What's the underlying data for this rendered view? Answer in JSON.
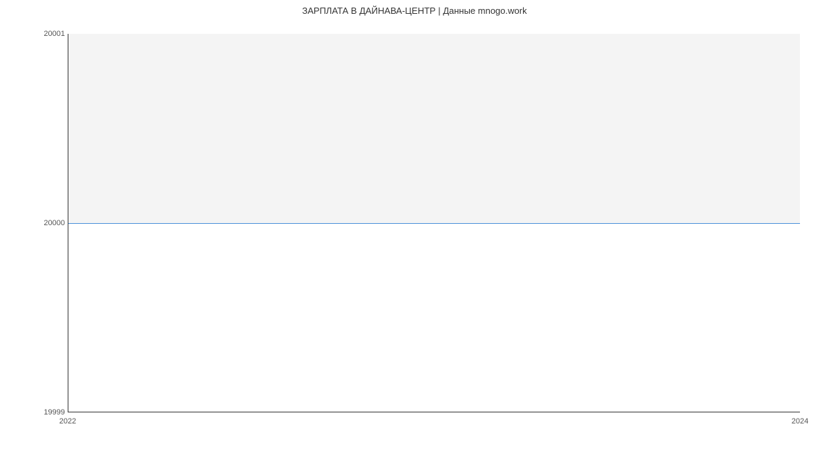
{
  "chart_data": {
    "type": "area",
    "title": "ЗАРПЛАТА В ДАЙНАВА-ЦЕНТР | Данные mnogo.work",
    "xlabel": "",
    "ylabel": "",
    "x": [
      2022,
      2024
    ],
    "values": [
      20000,
      20000
    ],
    "ylim": [
      19999,
      20001
    ],
    "y_ticks": [
      "20001",
      "20000",
      "19999"
    ],
    "x_ticks": [
      "2022",
      "2024"
    ]
  }
}
